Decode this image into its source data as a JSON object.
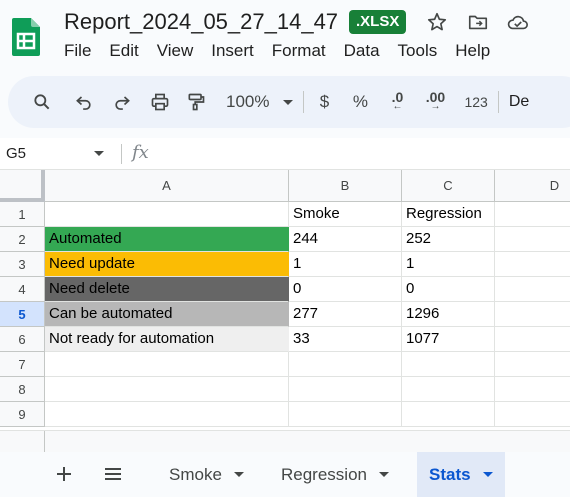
{
  "document": {
    "title": "Report_2024_05_27_14_47",
    "format_badge": ".XLSX"
  },
  "title_icons": [
    "star-icon",
    "move-to-folder-icon",
    "cloud-saved-icon"
  ],
  "menu": [
    "File",
    "Edit",
    "View",
    "Insert",
    "Format",
    "Data",
    "Tools",
    "Help"
  ],
  "toolbar": {
    "zoom": "100%",
    "currency": "$",
    "percent": "%",
    "decrease_decimal": ".0",
    "increase_decimal": ".00",
    "number_format": "123",
    "default_font_partial": "De"
  },
  "formula_bar": {
    "cell_ref": "G5",
    "fx_label": "fx",
    "value": ""
  },
  "grid": {
    "columns": [
      "A",
      "B",
      "C",
      "D"
    ],
    "rows": [
      "1",
      "2",
      "3",
      "4",
      "5",
      "6",
      "7",
      "8",
      "9"
    ],
    "selected_row": "5",
    "data": [
      [
        "",
        "Smoke",
        "Regression",
        ""
      ],
      [
        "Automated",
        "244",
        "252",
        ""
      ],
      [
        "Need update",
        "1",
        "1",
        ""
      ],
      [
        "Need delete",
        "0",
        "0",
        ""
      ],
      [
        "Can be automated",
        "277",
        "1296",
        ""
      ],
      [
        "Not ready for automation",
        "33",
        "1077",
        ""
      ],
      [
        "",
        "",
        "",
        ""
      ],
      [
        "",
        "",
        "",
        ""
      ],
      [
        "",
        "",
        "",
        ""
      ]
    ],
    "label_fills": {
      "Automated": "#34a853",
      "Need update": "#fbbc04",
      "Need delete": "#666666",
      "Can be automated": "#b7b7b7",
      "Not ready for automation": "#efefef"
    }
  },
  "sheets": {
    "tabs": [
      "Smoke",
      "Regression",
      "Stats"
    ],
    "active": "Stats"
  },
  "colors": {
    "accent": "#0b57d0",
    "xlsx_badge": "#188038",
    "sheets_logo": "#0f9d58"
  }
}
